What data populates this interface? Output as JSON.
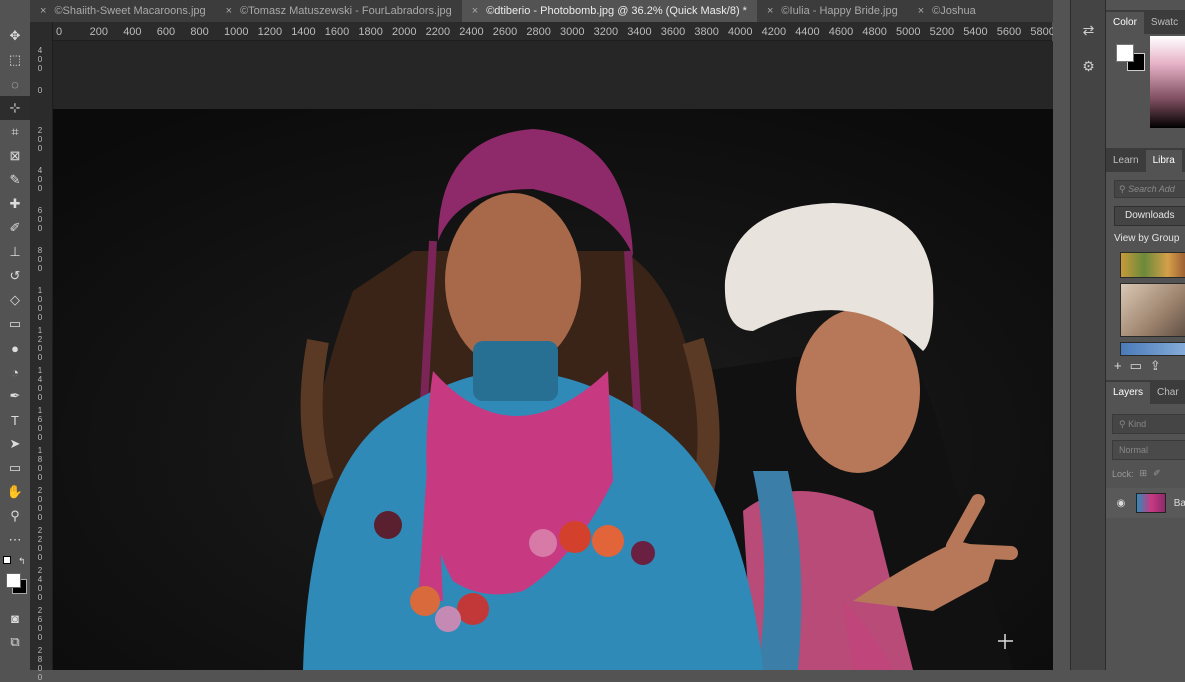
{
  "tabs": [
    {
      "label": "©Shaiith-Sweet Macaroons.jpg",
      "active": false
    },
    {
      "label": "©Tomasz Matuszewski - FourLabradors.jpg",
      "active": false
    },
    {
      "label": "©dtiberio - Photobomb.jpg @ 36.2% (Quick Mask/8) *",
      "active": true
    },
    {
      "label": "©Iulia - Happy Bride.jpg",
      "active": false
    },
    {
      "label": "©Joshua",
      "active": false
    }
  ],
  "tab_close_glyph": "×",
  "tab_overflow_glyph": "»",
  "ruler_top_ticks": [
    "0",
    "200",
    "400",
    "600",
    "800",
    "1000",
    "1200",
    "1400",
    "1600",
    "1800",
    "2000",
    "2200",
    "2400",
    "2600",
    "2800",
    "3000",
    "3200",
    "3400",
    "3600",
    "3800",
    "4000",
    "4200",
    "4400",
    "4600",
    "4800",
    "5000",
    "5200",
    "5400",
    "5600",
    "5800"
  ],
  "ruler_left_ticks": [
    "400",
    "0",
    "200",
    "400",
    "600",
    "800",
    "1000",
    "1200",
    "1400",
    "1600",
    "1800",
    "2000",
    "2200",
    "2400",
    "2600",
    "2800"
  ],
  "tools": [
    {
      "name": "move-tool-icon",
      "glyph": "✥"
    },
    {
      "name": "marquee-tool-icon",
      "glyph": "⬚"
    },
    {
      "name": "lasso-tool-icon",
      "glyph": "◌"
    },
    {
      "name": "quick-selection-tool-icon",
      "glyph": "⊹"
    },
    {
      "name": "crop-tool-icon",
      "glyph": "⌗"
    },
    {
      "name": "frame-tool-icon",
      "glyph": "⊠"
    },
    {
      "name": "eyedropper-tool-icon",
      "glyph": "✎"
    },
    {
      "name": "healing-brush-tool-icon",
      "glyph": "✚"
    },
    {
      "name": "brush-tool-icon",
      "glyph": "✐"
    },
    {
      "name": "clone-stamp-tool-icon",
      "glyph": "⊥"
    },
    {
      "name": "history-brush-tool-icon",
      "glyph": "↺"
    },
    {
      "name": "eraser-tool-icon",
      "glyph": "◇"
    },
    {
      "name": "gradient-tool-icon",
      "glyph": "▭"
    },
    {
      "name": "blur-tool-icon",
      "glyph": "●"
    },
    {
      "name": "dodge-tool-icon",
      "glyph": "◔"
    },
    {
      "name": "pen-tool-icon",
      "glyph": "✒"
    },
    {
      "name": "type-tool-icon",
      "glyph": "T"
    },
    {
      "name": "path-selection-tool-icon",
      "glyph": "➤"
    },
    {
      "name": "rectangle-tool-icon",
      "glyph": "▭"
    },
    {
      "name": "hand-tool-icon",
      "glyph": "✋"
    },
    {
      "name": "zoom-tool-icon",
      "glyph": "⚲"
    },
    {
      "name": "more-tools-icon",
      "glyph": "⋯"
    }
  ],
  "tool_selected_index": 3,
  "bottom_tools": [
    {
      "name": "quick-mask-icon",
      "glyph": "◙"
    },
    {
      "name": "screen-mode-icon",
      "glyph": "⧉"
    }
  ],
  "right_icons": [
    {
      "name": "history-panel-icon",
      "glyph": "⇄"
    },
    {
      "name": "properties-panel-icon",
      "glyph": "⚙"
    }
  ],
  "color_panel": {
    "tabs": [
      {
        "label": "Color",
        "active": true
      },
      {
        "label": "Swatc",
        "active": false
      }
    ],
    "foreground": "#ffffff",
    "background": "#000000"
  },
  "libraries_panel": {
    "tabs": [
      {
        "label": "Learn",
        "active": false
      },
      {
        "label": "Libra",
        "active": true
      }
    ],
    "search_placeholder": "Search Add",
    "library_dropdown": "Downloads",
    "view_by": "View by Group"
  },
  "layers_panel": {
    "tabs": [
      {
        "label": "Layers",
        "active": true
      },
      {
        "label": "Char",
        "active": false
      }
    ],
    "kind_placeholder": "Kind",
    "blend_mode": "Normal",
    "lock_label": "Lock:",
    "layer_name": "Ba"
  },
  "colors": {
    "hat_left": "#8e2a6a",
    "hat_right": "#e8e4dd",
    "sweater": "#2f8ab8",
    "scarf": "#c73a82"
  }
}
